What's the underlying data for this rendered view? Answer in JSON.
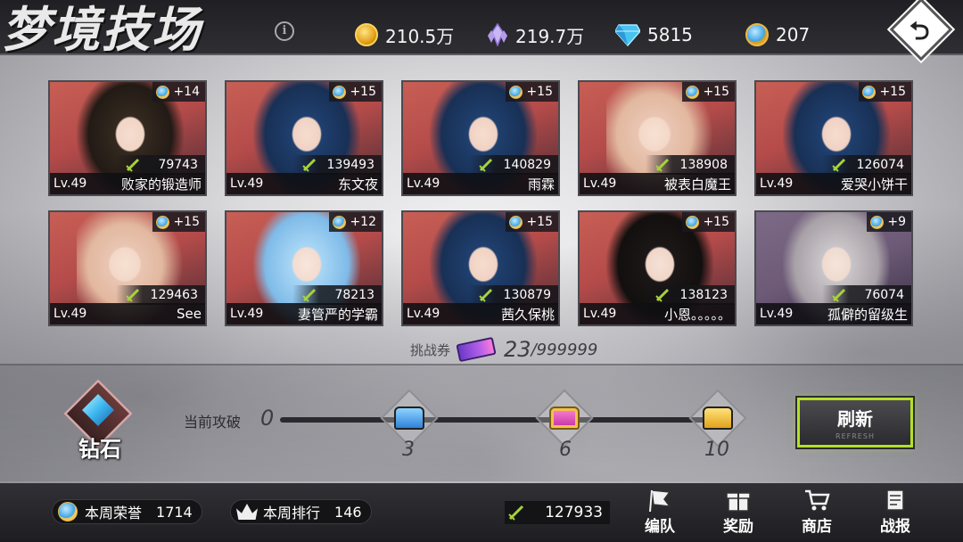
{
  "title": "梦境技场",
  "currencies": [
    {
      "icon": "gold-coin-icon",
      "value": "210.5万"
    },
    {
      "icon": "crystal-icon",
      "value": "219.7万"
    },
    {
      "icon": "diamond-gem-icon",
      "value": "5815"
    },
    {
      "icon": "arena-token-icon",
      "value": "207"
    }
  ],
  "opponents": [
    {
      "stars": "+14",
      "power": "79743",
      "level": "Lv.49",
      "name": "败家的锻造师",
      "hair": "dark"
    },
    {
      "stars": "+15",
      "power": "139493",
      "level": "Lv.49",
      "name": "东文夜",
      "hair": "blue"
    },
    {
      "stars": "+15",
      "power": "140829",
      "level": "Lv.49",
      "name": "雨霖",
      "hair": "blue"
    },
    {
      "stars": "+15",
      "power": "138908",
      "level": "Lv.49",
      "name": "被表白魔王",
      "hair": "blonde"
    },
    {
      "stars": "+15",
      "power": "126074",
      "level": "Lv.49",
      "name": "爱哭小饼干",
      "hair": "blue"
    },
    {
      "stars": "+15",
      "power": "129463",
      "level": "Lv.49",
      "name": "See",
      "hair": "blonde"
    },
    {
      "stars": "+12",
      "power": "78213",
      "level": "Lv.49",
      "name": "妻管严的学霸",
      "hair": "light"
    },
    {
      "stars": "+15",
      "power": "130879",
      "level": "Lv.49",
      "name": "茜久保桃",
      "hair": "blue"
    },
    {
      "stars": "+15",
      "power": "138123",
      "level": "Lv.49",
      "name": "小恩。。。。。",
      "hair": "black"
    },
    {
      "stars": "+9",
      "power": "76074",
      "level": "Lv.49",
      "name": "孤僻的留级生",
      "hair": "grey"
    }
  ],
  "tickets": {
    "label": "挑战券",
    "count": "23",
    "max": "/999999"
  },
  "rank": {
    "label": "钻石"
  },
  "progress": {
    "label": "当前攻破",
    "current": "0",
    "milestones": [
      {
        "value": "3",
        "chest": "blue-chest-icon"
      },
      {
        "value": "6",
        "chest": "pink-chest-icon"
      },
      {
        "value": "10",
        "chest": "gold-chest-icon"
      }
    ]
  },
  "refresh": {
    "label": "刷新",
    "sub": "REFRESH"
  },
  "weekly_honor": {
    "label": "本周荣誉",
    "value": "1714"
  },
  "weekly_rank": {
    "label": "本周排行",
    "value": "146"
  },
  "my_power": "127933",
  "nav": [
    {
      "label": "编队",
      "icon": "team-flag-icon"
    },
    {
      "label": "奖励",
      "icon": "gift-icon"
    },
    {
      "label": "商店",
      "icon": "cart-icon"
    },
    {
      "label": "战报",
      "icon": "report-icon"
    }
  ],
  "colors": {
    "accent": "#b3e02a",
    "topbar": "#202024",
    "card_red": "#c75f55"
  }
}
